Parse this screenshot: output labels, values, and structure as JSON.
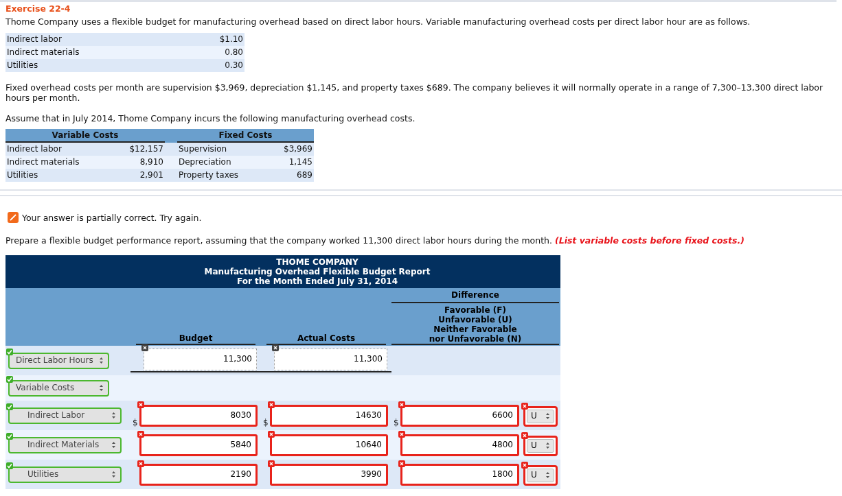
{
  "exercise_title": "Exercise 22-4",
  "intro": "Thome Company uses a flexible budget for manufacturing overhead based on direct labor hours. Variable manufacturing overhead costs per direct labor hour are as follows.",
  "rates": [
    {
      "label": "Indirect labor",
      "value": "$1.10"
    },
    {
      "label": "Indirect materials",
      "value": "0.80"
    },
    {
      "label": "Utilities",
      "value": "0.30"
    }
  ],
  "fixed_text": "Fixed overhead costs per month are supervision $3,969, depreciation $1,145, and property taxes $689. The company believes it will normally operate in a range of 7,300–13,300 direct labor hours per month.",
  "assume_text": "Assume that in July 2014, Thome Company incurs the following manufacturing overhead costs.",
  "costs_table": {
    "variable_header": "Variable Costs",
    "fixed_header": "Fixed Costs",
    "rows": [
      {
        "variable_label": "Indirect labor",
        "variable_amount": "$12,157",
        "fixed_label": "Supervision",
        "fixed_amount": "$3,969"
      },
      {
        "variable_label": "Indirect materials",
        "variable_amount": "8,910",
        "fixed_label": "Depreciation",
        "fixed_amount": "1,145"
      },
      {
        "variable_label": "Utilities",
        "variable_amount": "2,901",
        "fixed_label": "Property taxes",
        "fixed_amount": "689"
      }
    ]
  },
  "feedback": "Your answer is partially correct.  Try again.",
  "instruction": "Prepare a flexible budget performance report, assuming that the company worked 11,300 direct labor hours during the month.",
  "instruction_note": "(List variable costs before fixed costs.)",
  "report": {
    "title_lines": [
      "THOME COMPANY",
      "Manufacturing Overhead Flexible Budget Report",
      "For the Month Ended July 31, 2014"
    ],
    "budget_header": "Budget",
    "actual_header": "Actual Costs",
    "difference_header": "Difference",
    "difference_legend": [
      "Favorable (F)",
      "Unfavorable (U)",
      "Neither Favorable",
      "nor Unfavorable (N)"
    ],
    "rows": [
      {
        "kind": "hours",
        "label": "Direct Labor Hours",
        "label_correct": true,
        "budget": {
          "value": "11,300",
          "graded": false
        },
        "actual": {
          "value": "11,300",
          "graded": false
        }
      },
      {
        "kind": "heading",
        "label": "Variable Costs",
        "label_correct": true
      },
      {
        "kind": "cost",
        "label": "Indirect Labor",
        "label_correct": true,
        "dollar": "$",
        "budget": {
          "value": "8030",
          "graded": true,
          "correct": false
        },
        "actual": {
          "value": "14630",
          "graded": true,
          "correct": false
        },
        "difference": {
          "value": "6600",
          "graded": true,
          "correct": false
        },
        "direction": {
          "value": "U",
          "graded": true,
          "correct": false
        }
      },
      {
        "kind": "cost",
        "label": "Indirect Materials",
        "label_correct": true,
        "budget": {
          "value": "5840",
          "graded": true,
          "correct": false
        },
        "actual": {
          "value": "10640",
          "graded": true,
          "correct": false
        },
        "difference": {
          "value": "4800",
          "graded": true,
          "correct": false
        },
        "direction": {
          "value": "U",
          "graded": true,
          "correct": false
        }
      },
      {
        "kind": "cost",
        "label": "Utilities",
        "label_correct": true,
        "budget": {
          "value": "2190",
          "graded": true,
          "correct": false
        },
        "actual": {
          "value": "3990",
          "graded": true,
          "correct": false
        },
        "difference": {
          "value": "1800",
          "graded": true,
          "correct": false
        },
        "direction": {
          "value": "U",
          "graded": true,
          "correct": false
        }
      }
    ]
  }
}
